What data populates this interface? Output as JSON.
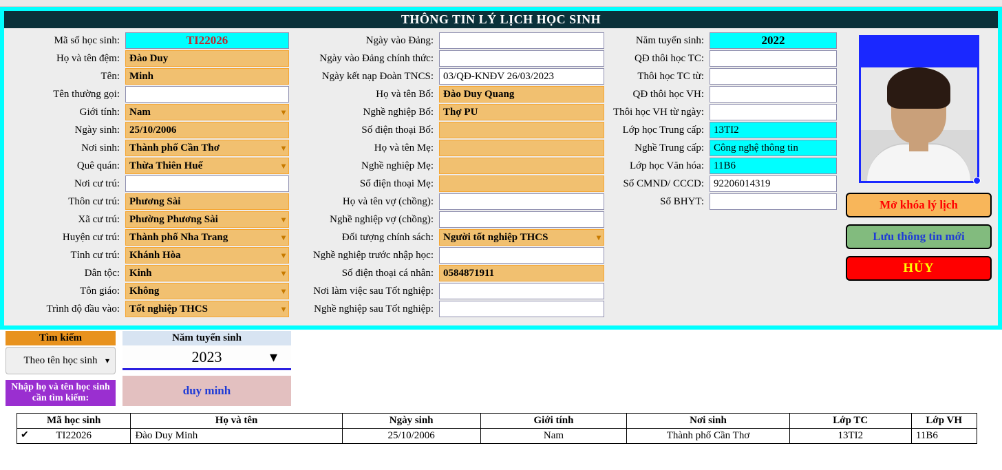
{
  "title": "THÔNG TIN LÝ LỊCH HỌC SINH",
  "labels": {
    "ma_so": "Mã số học sinh:",
    "ho_dem": "Họ và tên đệm:",
    "ten": "Tên:",
    "ten_goi": "Tên thường gọi:",
    "gioi_tinh": "Giới tính:",
    "ngay_sinh": "Ngày sinh:",
    "noi_sinh": "Nơi sinh:",
    "que_quan": "Quê quán:",
    "noi_cu_tru": "Nơi cư trú:",
    "thon_cu_tru": "Thôn cư trú:",
    "xa_cu_tru": "Xã cư trú:",
    "huyen_cu_tru": "Huyện cư trú:",
    "tinh_cu_tru": "Tỉnh cư trú:",
    "dan_toc": "Dân tộc:",
    "ton_giao": "Tôn giáo:",
    "trinh_do": "Trình độ đầu vào:",
    "ngay_vao_dang": "Ngày vào Đảng:",
    "ngay_vao_dang_ct": "Ngày vào Đảng chính thức:",
    "ngay_kn_doan": "Ngày kết nạp Đoàn TNCS:",
    "ho_ten_bo": "Họ và tên Bố:",
    "nghe_bo": "Nghề nghiệp Bố:",
    "sdt_bo": "Số điện thoại Bố:",
    "ho_ten_me": "Họ và tên Mẹ:",
    "nghe_me": "Nghề nghiệp Mẹ:",
    "sdt_me": "Số điện thoại Mẹ:",
    "vo_chong": "Họ và tên vợ (chồng):",
    "nghe_vc": "Nghề nghiệp vợ (chồng):",
    "doi_tuong": "Đối tượng chính sách:",
    "nghe_truoc": "Nghề nghiệp trước nhập học:",
    "sdt_cn": "Số điện thoại cá nhân:",
    "noi_lam_sau": "Nơi làm việc sau Tốt nghiệp:",
    "nghe_sau": "Nghề nghiệp sau Tốt nghiệp:",
    "nam_ts": "Năm tuyển sinh:",
    "qd_thoi_tc": "QĐ thôi học TC:",
    "thoi_tc_tu": "Thôi học TC từ:",
    "qd_thoi_vh": "QĐ thôi học VH:",
    "thoi_vh_tu": "Thôi học VH từ ngày:",
    "lop_tc": "Lớp học Trung cấp:",
    "nghe_tc": "Nghề Trung cấp:",
    "lop_vh": "Lớp học Văn hóa:",
    "cccd": "Số CMND/ CCCD:",
    "bhyt": "Số BHYT:"
  },
  "values": {
    "ma_so": "TI22026",
    "ho_dem": "Đào Duy",
    "ten": "Minh",
    "ten_goi": "",
    "gioi_tinh": "Nam",
    "ngay_sinh": "25/10/2006",
    "noi_sinh": "Thành phố Cần Thơ",
    "que_quan": "Thừa Thiên Huế",
    "noi_cu_tru": "",
    "thon_cu_tru": "Phương Sài",
    "xa_cu_tru": "Phường Phương Sài",
    "huyen_cu_tru": "Thành phố Nha Trang",
    "tinh_cu_tru": "Khánh Hòa",
    "dan_toc": "Kinh",
    "ton_giao": "Không",
    "trinh_do": "Tốt nghiệp THCS",
    "ngay_vao_dang": "",
    "ngay_vao_dang_ct": "",
    "ngay_kn_doan": "03/QĐ-KNĐV 26/03/2023",
    "ho_ten_bo": "Đào Duy Quang",
    "nghe_bo": "Thợ PU",
    "sdt_bo": "",
    "ho_ten_me": "",
    "nghe_me": "",
    "sdt_me": "",
    "vo_chong": "",
    "nghe_vc": "",
    "doi_tuong": "Người tốt nghiệp THCS",
    "nghe_truoc": "",
    "sdt_cn": "0584871911",
    "noi_lam_sau": "",
    "nghe_sau": "",
    "nam_ts": "2022",
    "qd_thoi_tc": "",
    "thoi_tc_tu": "",
    "qd_thoi_vh": "",
    "thoi_vh_tu": "",
    "lop_tc": "13TI2",
    "nghe_tc": "Công nghệ thông tin",
    "lop_vh": "11B6",
    "cccd": "92206014319",
    "bhyt": ""
  },
  "buttons": {
    "unlock": "Mở khóa lý lịch",
    "save": "Lưu thông tin mới",
    "cancel": "HỦY"
  },
  "search": {
    "tim_kiem": "Tìm kiếm",
    "by": "Theo tên học sinh",
    "nam_ts_lbl": "Năm tuyển sinh",
    "nam_ts_val": "2023",
    "prompt": "Nhập họ và tên học sinh cần tìm kiếm:",
    "query": "duy minh"
  },
  "table": {
    "headers": [
      "Mã học sinh",
      "Họ và tên",
      "Ngày sinh",
      "Giới tính",
      "Nơi sinh",
      "Lớp TC",
      "Lớp VH"
    ],
    "rows": [
      [
        "TI22026",
        "Đào Duy Minh",
        "25/10/2006",
        "Nam",
        "Thành phố Cần Thơ",
        "13TI2",
        "11B6"
      ]
    ]
  }
}
